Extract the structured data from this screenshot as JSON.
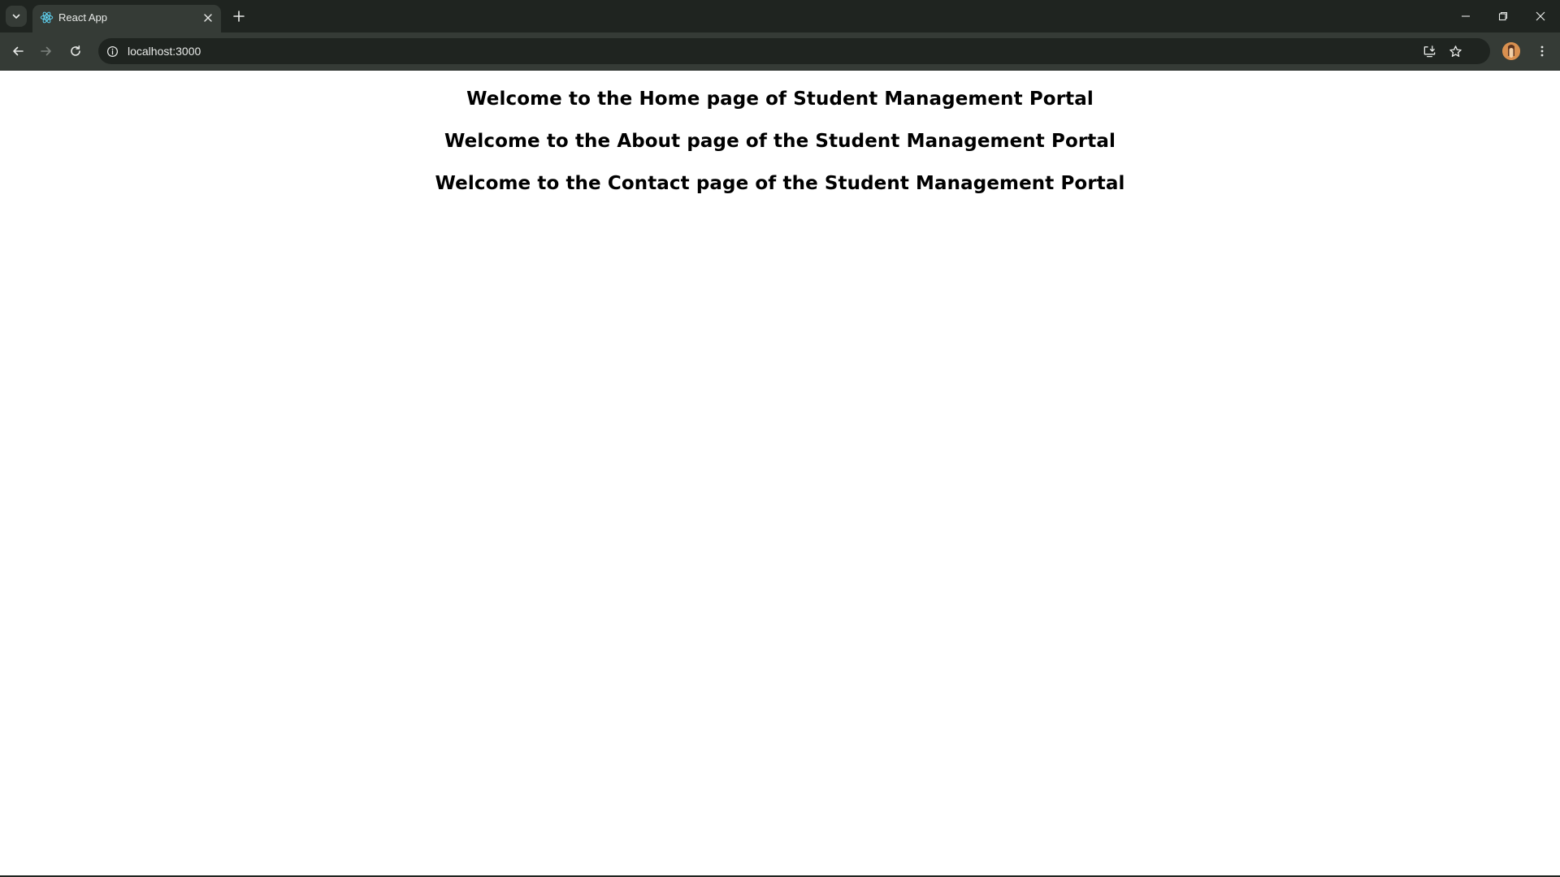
{
  "browser": {
    "tab": {
      "title": "React App",
      "favicon": "react-logo-icon"
    },
    "address_bar": {
      "url": "localhost:3000"
    },
    "colors": {
      "frame": "#1f2420",
      "toolbar": "#353b36",
      "icon": "#c7cbc7",
      "react_blue": "#61dafb"
    }
  },
  "page": {
    "headings": [
      "Welcome to the Home page of Student Management Portal",
      "Welcome to the About page of the Student Management Portal",
      "Welcome to the Contact page of the Student Management Portal"
    ]
  }
}
